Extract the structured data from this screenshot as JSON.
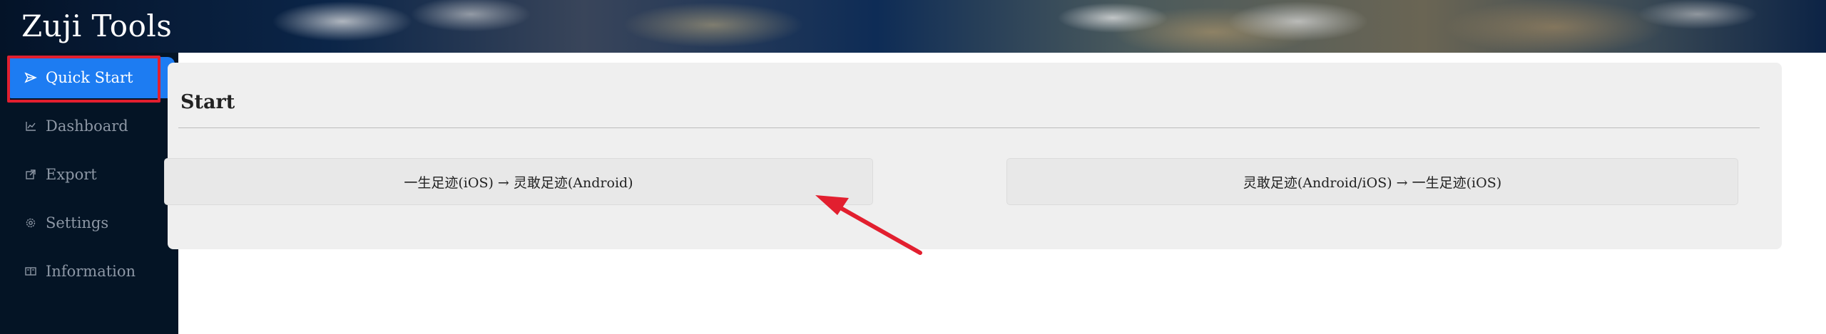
{
  "header": {
    "app_title": "Zuji Tools"
  },
  "sidebar": {
    "items": [
      {
        "label": "Quick Start",
        "icon": "send-icon",
        "active": true
      },
      {
        "label": "Dashboard",
        "icon": "chart-icon",
        "active": false
      },
      {
        "label": "Export",
        "icon": "external-link-icon",
        "active": false
      },
      {
        "label": "Settings",
        "icon": "gear-icon",
        "active": false
      },
      {
        "label": "Information",
        "icon": "book-icon",
        "active": false
      }
    ]
  },
  "main": {
    "card_title": "Start",
    "buttons": [
      {
        "label": "一生足迹(iOS) → 灵敢足迹(Android)"
      },
      {
        "label": "灵敢足迹(Android/iOS) → 一生足迹(iOS)"
      }
    ]
  },
  "annotation": {
    "color": "#e21f2f"
  },
  "colors": {
    "accent": "#1d7cf2",
    "sidebar_bg": "#041425"
  }
}
